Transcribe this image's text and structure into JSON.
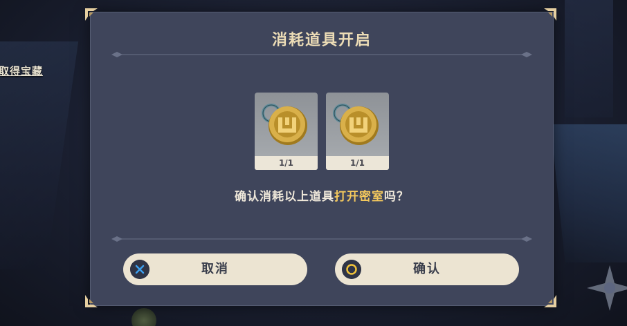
{
  "background": {
    "side_label": "取得宝藏"
  },
  "dialog": {
    "title": "消耗道具开启",
    "items": [
      {
        "icon": "maze-key-coin-icon",
        "count": "1/1"
      },
      {
        "icon": "maze-key-coin-icon",
        "count": "1/1"
      }
    ],
    "question_prefix": "确认消耗以上道具",
    "question_highlight": "打开密室",
    "question_suffix": "吗？",
    "cancel_label": "取消",
    "confirm_label": "确认",
    "cancel_icon": "cross-icon",
    "confirm_icon": "circle-icon"
  },
  "colors": {
    "panel": "#3f455b",
    "title": "#ecdcb6",
    "highlight": "#f4c95d",
    "button_bg": "#ece4d2",
    "cancel_icon": "#3da0f0",
    "confirm_icon": "#f0c23a"
  }
}
